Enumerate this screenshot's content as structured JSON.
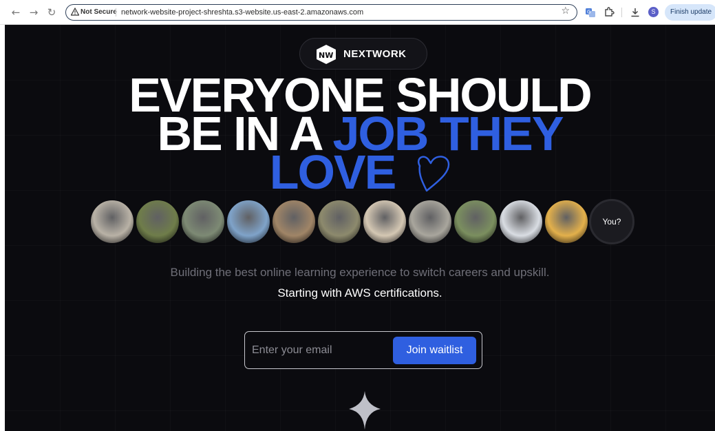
{
  "browser": {
    "security_label": "Not Secure",
    "url": "network-website-project-shreshta.s3-website.us-east-2.amazonaws.com",
    "profile_initial": "S",
    "finish_update_label": "Finish update"
  },
  "brand": {
    "name": "NEXTWORK",
    "logo_letters": "NW"
  },
  "headline": {
    "line1": "EVERYONE SHOULD",
    "line2_white": "BE IN A ",
    "line2_blue": "JOB THEY",
    "line3_blue": "LOVE"
  },
  "avatars": [
    {
      "icon": "sheep-photo-icon",
      "bg": "#b9b2a6"
    },
    {
      "icon": "squirrel-photo-icon",
      "bg": "#6f7d4a"
    },
    {
      "icon": "koala-photo-icon",
      "bg": "#7d8a74"
    },
    {
      "icon": "giraffe-photo-icon",
      "bg": "#7fa3c9"
    },
    {
      "icon": "cat-photo-icon",
      "bg": "#a08567"
    },
    {
      "icon": "sloth-photo-icon",
      "bg": "#8d8a6d"
    },
    {
      "icon": "pug-photo-icon",
      "bg": "#d4c7b3"
    },
    {
      "icon": "seal-photo-icon",
      "bg": "#a9a69d"
    },
    {
      "icon": "alpaca-photo-icon",
      "bg": "#7b8f5f"
    },
    {
      "icon": "pineapple-photo-icon",
      "bg": "#d9dde3"
    },
    {
      "icon": "black-pug-photo-icon",
      "bg": "#e3b04b"
    }
  ],
  "you_label": "You?",
  "subtitle": "Building the best online learning experience to switch careers and upskill.",
  "subtitle2": "Starting with AWS certifications.",
  "form": {
    "placeholder": "Enter your email",
    "button_label": "Join waitlist"
  },
  "colors": {
    "accent": "#2f5fe0",
    "background": "#0b0b0f"
  }
}
